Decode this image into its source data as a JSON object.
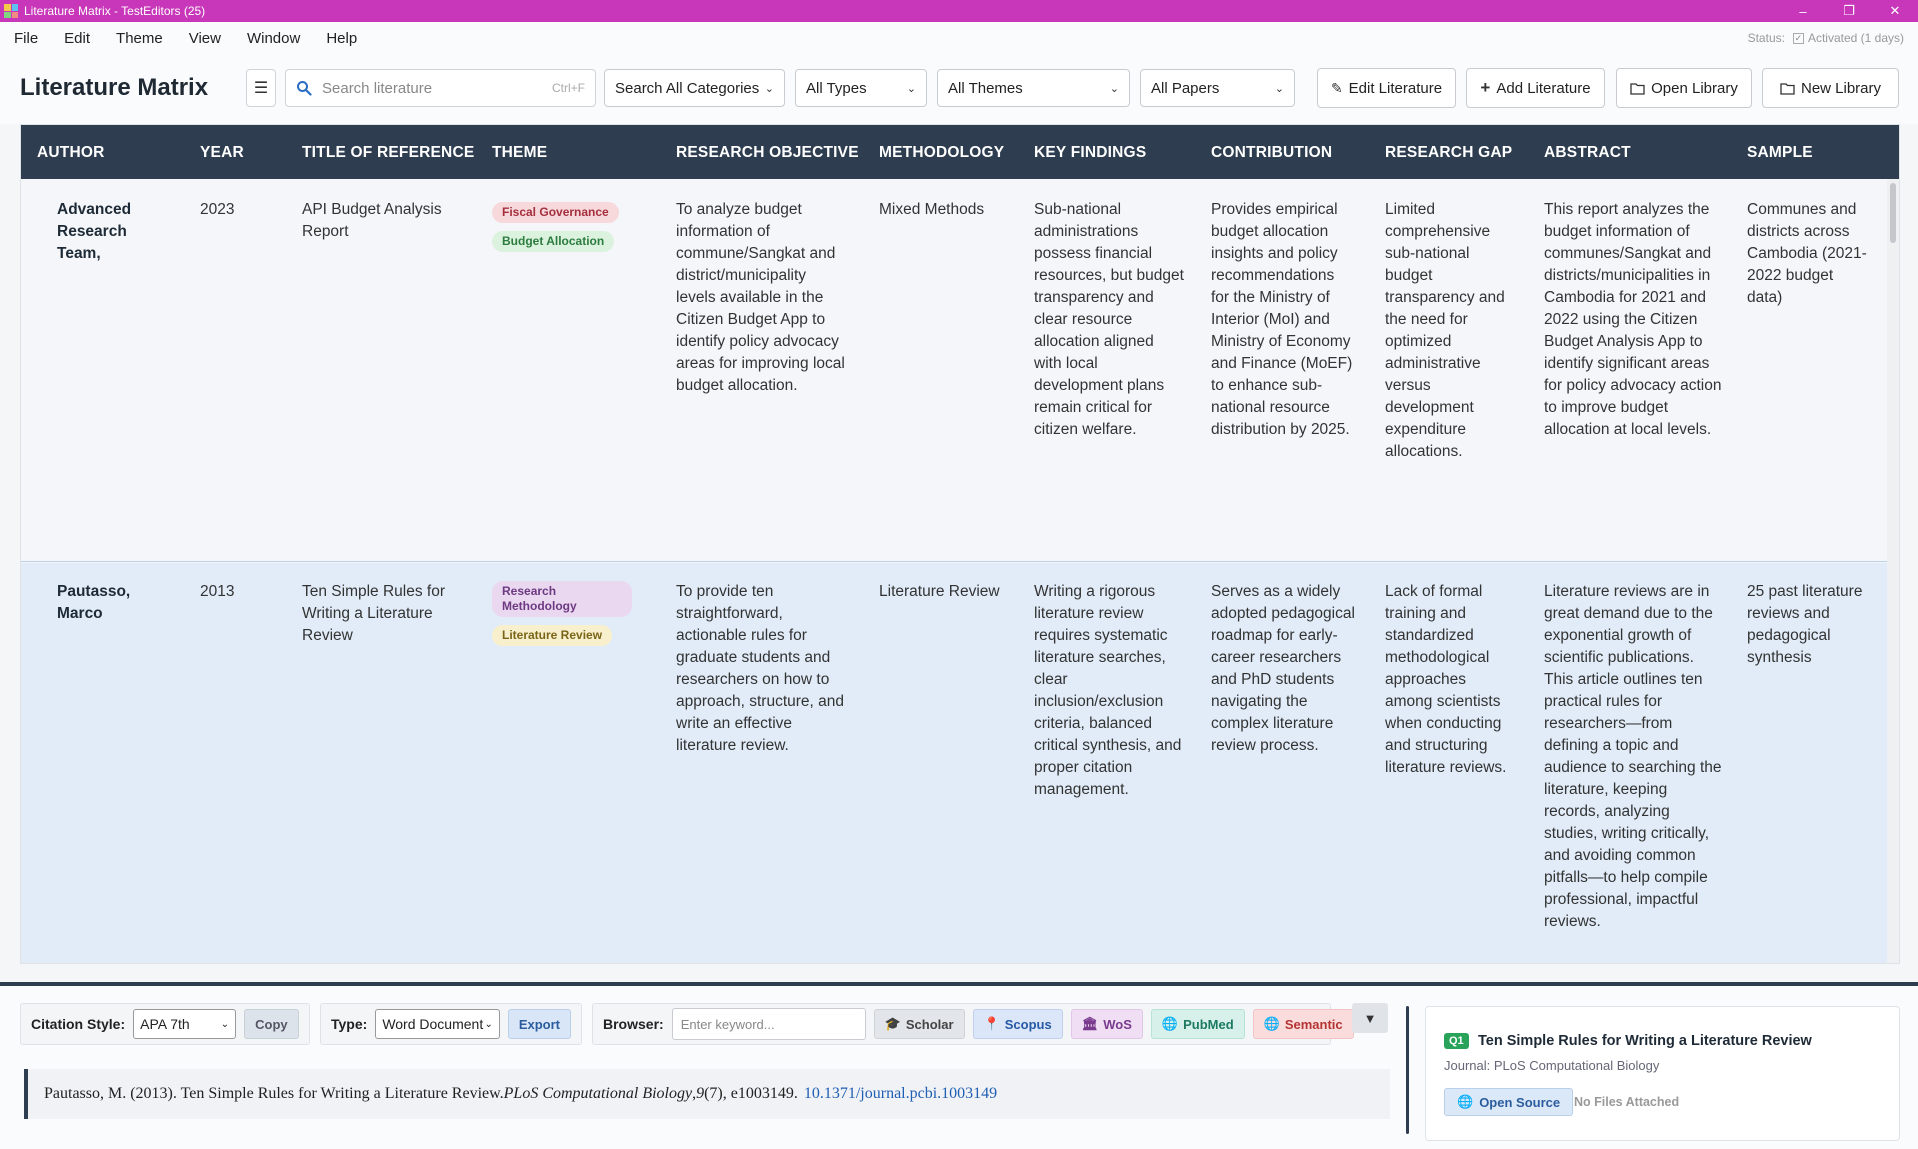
{
  "window": {
    "title": "Literature Matrix - TestEditors (25)",
    "controls": {
      "minimize": "–",
      "restore": "❐",
      "close": "✕"
    }
  },
  "menu": {
    "items": [
      "File",
      "Edit",
      "Theme",
      "View",
      "Window",
      "Help"
    ],
    "status": "Status:",
    "status_value": "Activated (1 days)"
  },
  "header": {
    "title": "Literature Matrix",
    "search_placeholder": "Search literature",
    "search_shortcut": "Ctrl+F",
    "filters": {
      "category": "Search All Categories",
      "type": "All Types",
      "theme": "All Themes",
      "papers": "All Papers"
    },
    "buttons": {
      "edit": "Edit Literature",
      "add": "Add Literature",
      "open": "Open Library",
      "new": "New Library"
    }
  },
  "table": {
    "columns": [
      "AUTHOR",
      "YEAR",
      "TITLE OF REFERENCE",
      "THEME",
      "RESEARCH OBJECTIVE",
      "METHODOLOGY",
      "KEY FINDINGS",
      "CONTRIBUTION",
      "RESEARCH GAP",
      "ABSTRACT",
      "SAMPLE"
    ],
    "rows": [
      {
        "author": "Advanced Research Team,",
        "year": "2023",
        "title": "API Budget Analysis Report",
        "themes": [
          "Fiscal Governance",
          "Budget Allocation"
        ],
        "objective": "To analyze budget information of commune/Sangkat and district/municipality levels available in the Citizen Budget App to identify policy advocacy areas for improving local budget allocation.",
        "methodology": "Mixed Methods",
        "findings": "Sub-national administrations possess financial resources, but budget transparency and clear resource allocation aligned with local development plans remain critical for citizen welfare.",
        "contribution": "Provides empirical budget allocation insights and policy recommendations for the Ministry of Interior (MoI) and Ministry of Economy and Finance (MoEF) to enhance sub-national resource distribution by 2025.",
        "gap": "Limited comprehensive sub-national budget transparency and the need for optimized administrative versus development expenditure allocations.",
        "abstract": "This report analyzes the budget information of communes/Sangkat and districts/municipalities in Cambodia for 2021 and 2022 using the Citizen Budget Analysis App to identify significant areas for policy advocacy action to improve budget allocation at local levels.",
        "sample": "Communes and districts across Cambodia (2021-2022 budget data)"
      },
      {
        "author": "Pautasso, Marco",
        "year": "2013",
        "title": "Ten Simple Rules for Writing a Literature Review",
        "themes": [
          "Research Methodology",
          "Literature Review"
        ],
        "objective": "To provide ten straightforward, actionable rules for graduate students and researchers on how to approach, structure, and write an effective literature review.",
        "methodology": "Literature Review",
        "findings": "Writing a rigorous literature review requires systematic literature searches, clear inclusion/exclusion criteria, balanced critical synthesis, and proper citation management.",
        "contribution": "Serves as a widely adopted pedagogical roadmap for early-career researchers and PhD students navigating the complex literature review process.",
        "gap": "Lack of formal training and standardized methodological approaches among scientists when conducting and structuring literature reviews.",
        "abstract": "Literature reviews are in great demand due to the exponential growth of scientific publications. This article outlines ten practical rules for researchers—from defining a topic and audience to searching the literature, keeping records, analyzing studies, writing critically, and avoiding common pitfalls—to help compile professional, impactful reviews.",
        "sample": "25 past literature reviews and pedagogical synthesis"
      }
    ]
  },
  "bottom": {
    "citation_label": "Citation Style:",
    "citation_style": "APA 7th",
    "copy": "Copy",
    "type_label": "Type:",
    "type_value": "Word Document",
    "export": "Export",
    "browser_label": "Browser:",
    "keyword_placeholder": "Enter keyword...",
    "engines": [
      "Scholar",
      "Scopus",
      "WoS",
      "PubMed",
      "Semantic"
    ],
    "collapse": "▼",
    "citation": {
      "prefix": "Pautasso, M. (2013). Ten Simple Rules for Writing a Literature Review. ",
      "journal": "PLoS Computational Biology",
      "sep": ", ",
      "volume": "9",
      "rest": "(7), e1003149. ",
      "doi": "10.1371/journal.pcbi.1003149"
    },
    "card": {
      "rank": "Q1",
      "title": "Ten Simple Rules for Writing a Literature Review",
      "journal": "Journal: PLoS Computational Biology",
      "open_source": "Open Source",
      "files": "No Files Attached"
    }
  },
  "colors": {
    "titlebar": "#c837b9",
    "table_header": "#2e3e50",
    "selected_row": "#e1ecf8",
    "accent_blue": "#2b5d9e"
  }
}
